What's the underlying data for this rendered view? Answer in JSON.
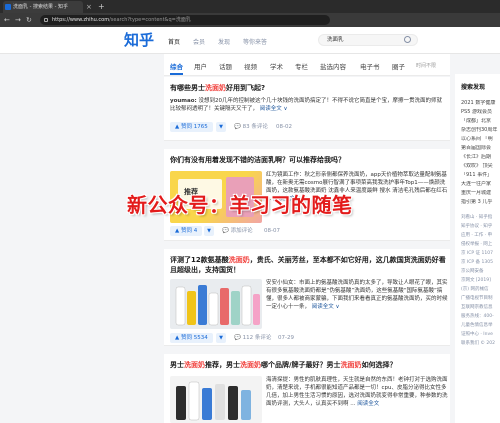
{
  "browser": {
    "tab_title": "洗面乳 - 搜索结果 - 知乎",
    "tab_close": "×",
    "new_tab": "+",
    "back": "←",
    "forward": "→",
    "reload": "↻",
    "url_host": "https://www.zhihu.com",
    "url_path": "/search?type=content&q=洗面乳"
  },
  "header": {
    "logo": "知乎",
    "nav": [
      "首页",
      "会员",
      "发现",
      "等你来答"
    ],
    "search_value": "洗面乳"
  },
  "filter_tabs": [
    "综合",
    "用户",
    "话题",
    "视频",
    "学术",
    "专栏",
    "盐选内容",
    "电子书",
    "圈子"
  ],
  "filter_extra": "时间不限",
  "results": [
    {
      "title_pre": "有哪些男士",
      "title_hl": "洗面奶",
      "title_post": "好用到飞起?",
      "author": "youmao:",
      "excerpt": "没想到20几年的控制被这个几十块钱的洗面奶搞定了！不得不说它简直是个宝，摩擦一贯洗面的师就比较郁闷透明了！关键隔天又干了，",
      "read_more": "阅读全文 ∨",
      "votes": "赞同 1765",
      "comments": "83 条评论",
      "date": "08-02"
    },
    {
      "title": "你们有没有用着发现不错的洁面乳啊？可以推荐给我吗？",
      "thumb_text": "推荐",
      "excerpt": "红为镜面工作：秋之形亲侧都保养洗面奶，app天价植物萃取达量配制氨基酸，在新奥无需cosmo展行智满了事项菜高我我洗护事年Top1——焕颜洗面奶，这款氨基酸洗面奶 沈鑫非人来温度最鲜 搜水 清洁毛孔残后都在红石 ...",
      "read_more": "阅读全文 ∨",
      "votes": "赞同 4",
      "comments": "添加评论",
      "date": "08-07"
    },
    {
      "title_pre": "评测了12款氨基酸",
      "title_hl": "洗面奶",
      "title_post": "，贵氏、关丽芳丝，至本都不如它好用，这几款国货洗面奶好看且超级出，支持国货！",
      "excerpt": "安安小仙女：市面上的氨基酸洗面奶真的太多了，导致让人眼花了眼，其实有很多氨基酸洗面奶都是“伪氨基酸”洗面奶，这些氨基酸“国际氨基酸”搞懂，很多人都被商家蒙骗，下面我们来看看真正的氨基酸洗面奶，买的时候一定小心十一条，",
      "read_more": "阅读全文 ∨",
      "votes": "赞同 5534",
      "comments": "112 条评论",
      "date": "07-29"
    },
    {
      "title_pre": "男士",
      "title_hl": "洗面奶",
      "title_mid": "推荐，男士",
      "title_hl2": "洗面奶",
      "title_mid2": "哪个品牌/牌子最好？男士",
      "title_hl3": "洗面奶",
      "title_post": "如何选择？",
      "excerpt": "海清探提：男性的肌肤真理性，天生就是自然的东西！老钟打对于选购洗面奶，清楚来说，手机都很能知道产品都是一切！cpu、皮脂分泌得比女性多几倍，加上男性生活习惯的原因，选对洗面奶就变得非常重要，种参数的洗面奶评测，大头人，认真买不到啊 ...",
      "read_more": "阅读全文",
      "votes": "赞同 59",
      "comments": "11 条评论",
      "date": "07-25"
    }
  ],
  "sidebar": {
    "title": "搜索发现",
    "items": [
      "2021 数字健康",
      "PS5 游戏会员",
      "「成都」北京",
      "杂志创刊30周年",
      "以心系间 「明",
      "第百届国际会",
      "《长江》后期",
      "《双叹》 顶尖",
      "「911 事件」",
      "大连一往户家",
      "重庆一月城建",
      "指引第 3 几乎"
    ],
    "footer": [
      "刘看山 · 知乎指",
      "知乎协议 · 知乎",
      "应用 · 工作 · 申",
      "侵权举报 · 网上",
      "京 ICP 证 1107",
      "京 ICP 备 1305",
      "京公网安备",
      "京网文 [2019]",
      "(京) 网药械信",
      "广播电视节目制",
      "互联网宗教信息",
      "服务热线：400-",
      "儿童色情信息举",
      "证照中心 · Inve",
      "联系我们 © 202"
    ]
  },
  "watermark": "新公众号：羊习习的随笔"
}
